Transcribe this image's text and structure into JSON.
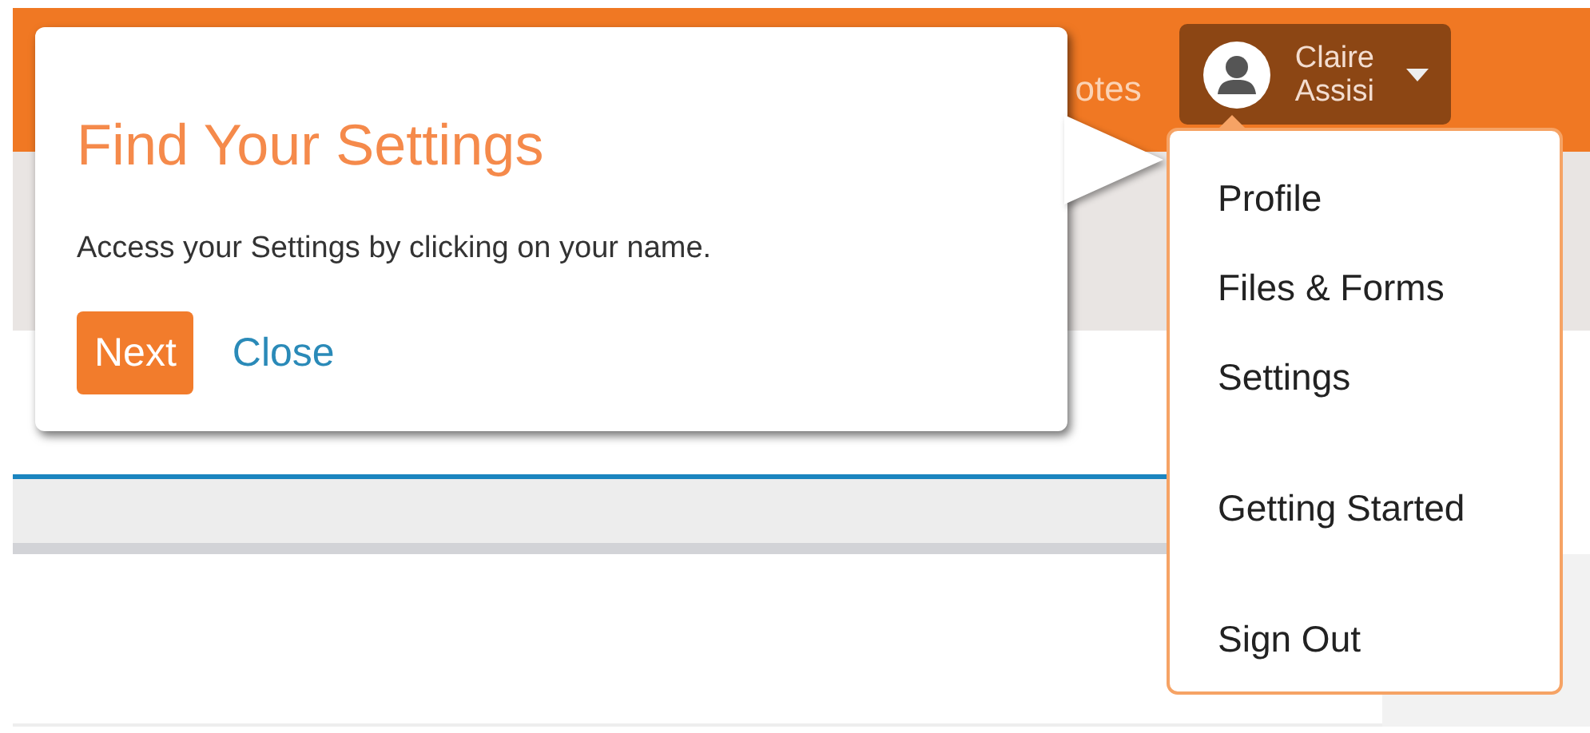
{
  "header": {
    "nav_items": [
      {
        "label": "otes"
      }
    ],
    "user": {
      "first_name": "Claire",
      "last_name": "Assisi",
      "menu_open": true
    }
  },
  "user_menu": {
    "groups": [
      {
        "items": [
          {
            "label": "Profile"
          },
          {
            "label": "Files & Forms"
          },
          {
            "label": "Settings"
          }
        ]
      },
      {
        "items": [
          {
            "label": "Getting Started"
          }
        ]
      },
      {
        "items": [
          {
            "label": "Sign Out"
          }
        ]
      }
    ]
  },
  "tour": {
    "title": "Find Your Settings",
    "text": "Access your Settings by clicking on your name.",
    "buttons": [
      {
        "label": "Next",
        "kind": "primary"
      },
      {
        "label": "Close",
        "kind": "link"
      }
    ]
  }
}
